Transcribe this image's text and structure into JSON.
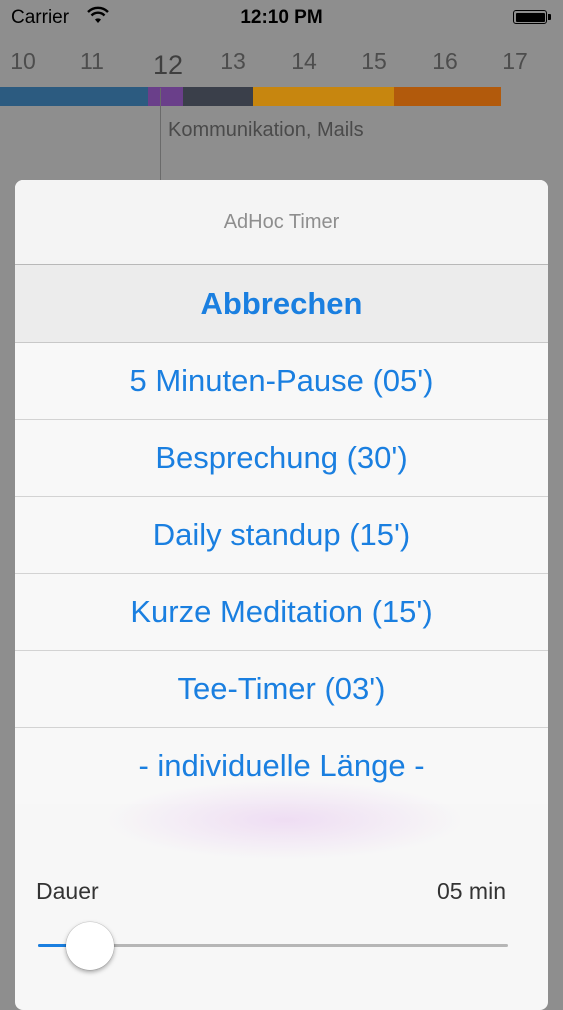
{
  "status_bar": {
    "carrier": "Carrier",
    "time": "12:10 PM",
    "icons": [
      "wifi-icon",
      "battery-icon"
    ]
  },
  "timeline": {
    "hours": [
      "10",
      "11",
      "12",
      "13",
      "14",
      "15",
      "16",
      "17"
    ],
    "current_hour": "12",
    "current_label": "Kommunikation, Mails",
    "segment_colors": [
      "#2c5b80",
      "#6a3f8a",
      "#3a3f4a",
      "#c7860f",
      "#b25a0c"
    ]
  },
  "sheet": {
    "title": "AdHoc Timer",
    "cancel_label": "Abbrechen",
    "options": [
      "5 Minuten-Pause (05')",
      "Besprechung (30')",
      "Daily standup (15')",
      "Kurze Meditation (15')",
      "Tee-Timer (03')",
      "- individuelle Länge -"
    ],
    "duration_label": "Dauer",
    "duration_value": "05 min",
    "slider_fraction": 0.11
  },
  "colors": {
    "accent": "#1a7fe0",
    "sheet_bg": "#f7f7f7",
    "dim_bg": "#8e8e8e"
  }
}
